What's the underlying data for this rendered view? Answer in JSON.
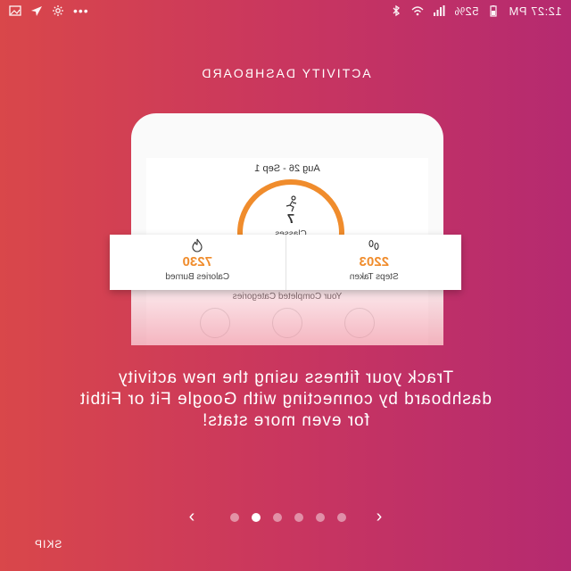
{
  "statusbar": {
    "time": "12:27 PM",
    "battery": "52%"
  },
  "title": "ACTIVITY DASHBOARD",
  "dashboard": {
    "date_range": "Aug 26 - Sep 1",
    "ring_value": "7",
    "ring_label": "Classes",
    "categories_label": "Your Completed Categories"
  },
  "stats": {
    "calories_value": "7230",
    "calories_label": "Calories Burned",
    "steps_value": "2203",
    "steps_label": "Steps Taken"
  },
  "description": "Track your fitness using the new activity dashboard by connecting with Google Fit or Fitbit for even more stats!",
  "pager": {
    "prev_symbol": "‹",
    "next_symbol": "›",
    "total_pages": 6,
    "active_page": 2
  },
  "skip_label": "SKIP",
  "colors": {
    "gradient_left": "#d9474a",
    "gradient_right": "#b52a70",
    "accent": "#f08c2c"
  },
  "icons": [
    "image-icon",
    "send-icon",
    "settings-icon",
    "bluetooth-icon",
    "wifi-icon",
    "signal-icon",
    "battery-icon",
    "running-figure-icon",
    "flame-icon",
    "footsteps-icon"
  ]
}
